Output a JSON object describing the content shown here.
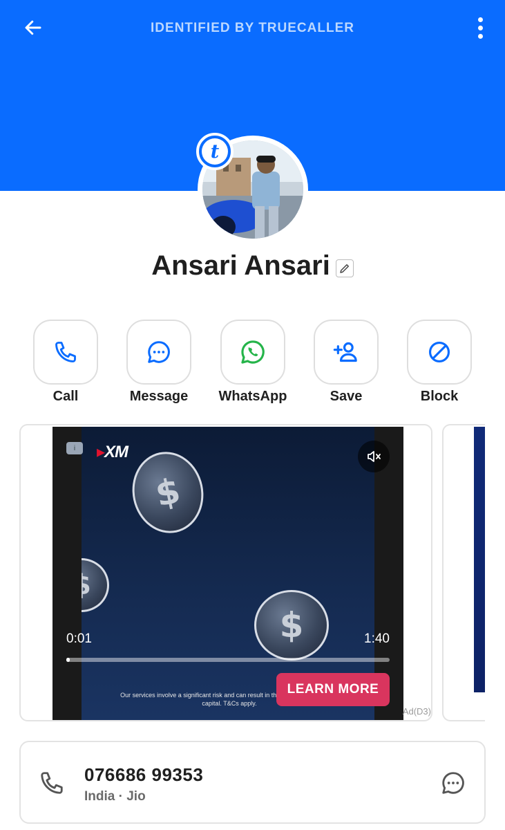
{
  "header": {
    "title": "IDENTIFIED BY TRUECALLER",
    "back_icon": "arrow-left-icon",
    "more_icon": "more-vertical-icon",
    "color": "#0a6cff"
  },
  "profile": {
    "name": "Ansari Ansari",
    "badge_letter": "t"
  },
  "actions": [
    {
      "label": "Call",
      "icon": "phone-icon"
    },
    {
      "label": "Message",
      "icon": "message-icon"
    },
    {
      "label": "WhatsApp",
      "icon": "whatsapp-icon"
    },
    {
      "label": "Save",
      "icon": "add-contact-icon"
    },
    {
      "label": "Block",
      "icon": "block-icon"
    }
  ],
  "ad": {
    "brand": "XM",
    "time_current": "0:01",
    "time_total": "1:40",
    "progress": 0.01,
    "disclaimer": "Our services involve a significant risk and can result in the loss of your invested capital. T&Cs apply.",
    "cta": "LEARN MORE",
    "tag": "Ad(D3)"
  },
  "contact": {
    "number": "076686 99353",
    "carrier": "India · Jio"
  },
  "colors": {
    "accent": "#0a6cff",
    "whatsapp": "#25b44a",
    "cta": "#d9355e"
  }
}
